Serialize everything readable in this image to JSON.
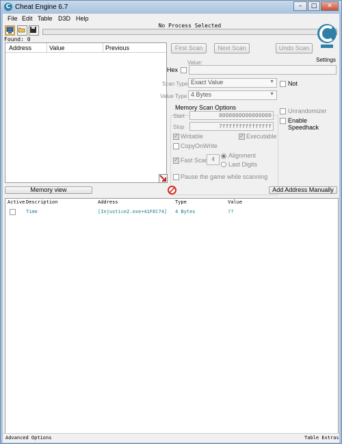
{
  "window": {
    "title": "Cheat Engine 6.7",
    "minimize": "–",
    "maximize": "□",
    "close": "✕"
  },
  "menu": [
    "File",
    "Edit",
    "Table",
    "D3D",
    "Help"
  ],
  "toolbar": {
    "process_label": "No Process Selected",
    "settings_label": "Settings",
    "open_process_icon": "computer-icon",
    "open_file_icon": "folder-icon",
    "save_icon": "floppy-disk-icon"
  },
  "found": "Found: 0",
  "results_list": {
    "columns": [
      "Address",
      "Value",
      "Previous"
    ]
  },
  "scan": {
    "first_scan": "First Scan",
    "next_scan": "Next Scan",
    "undo_scan": "Undo Scan",
    "value_label": "Value:",
    "hex_label": "Hex",
    "scan_type_label": "Scan Type",
    "scan_type_value": "Exact Value",
    "value_type_label": "Value Type",
    "value_type_value": "4 Bytes",
    "not_label": "Not",
    "memory_options_title": "Memory Scan Options",
    "start_label": "Start",
    "start_value": "0000000000000000",
    "stop_label": "Stop",
    "stop_value": "7fffffffffffffff",
    "writable_label": "Writable",
    "executable_label": "Executable",
    "copy_on_write_label": "CopyOnWrite",
    "fast_scan_label": "Fast Scan",
    "fast_scan_value": "4",
    "alignment_label": "Alignment",
    "last_digits_label": "Last Digits",
    "pause_label": "Pause the game while scanning",
    "unrandomizer_label": "Unrandomizer",
    "speedhack_label": "Enable Speedhack"
  },
  "actions": {
    "memory_view": "Memory view",
    "add_address": "Add Address Manually"
  },
  "address_list": {
    "columns": [
      "Active",
      "Description",
      "Address",
      "Type",
      "Value"
    ],
    "rows": [
      {
        "description": "Time",
        "address": "[Injustice2.exe+41FEC74]",
        "type": "4 Bytes",
        "value": "??"
      }
    ]
  },
  "statusbar": {
    "left": "Advanced Options",
    "right": "Table Extras"
  },
  "colors": {
    "accent": "#2f7fa9",
    "row_text": "#1a7a8a"
  }
}
